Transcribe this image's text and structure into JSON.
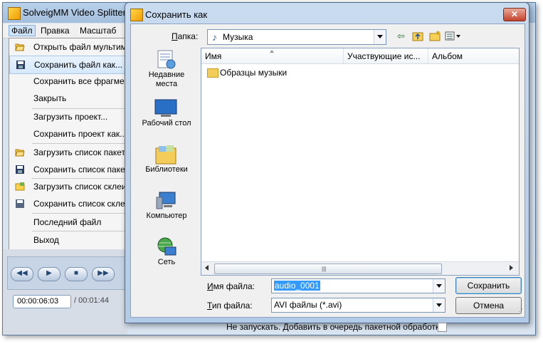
{
  "app": {
    "title": "SolveigMM Video Splitter",
    "menubar": [
      "Файл",
      "Правка",
      "Масштаб"
    ],
    "file_menu": [
      {
        "label": "Открыть файл мультим",
        "icon": "open-folder-icon"
      },
      {
        "label": "Сохранить файл как...",
        "icon": "floppy-icon",
        "highlighted": true
      },
      {
        "label": "Сохранить все фрагмен",
        "icon": ""
      },
      {
        "label": "Закрыть",
        "icon": ""
      },
      {
        "label": "Загрузить проект...",
        "icon": ""
      },
      {
        "label": "Сохранить проект как...",
        "icon": ""
      },
      {
        "label": "Загрузить список пакет",
        "icon": "open-folder-icon"
      },
      {
        "label": "Сохранить список паке",
        "icon": "floppy-icon"
      },
      {
        "label": "Загрузить список склеи",
        "icon": "folder-yellow-icon"
      },
      {
        "label": "Сохранить список скле",
        "icon": "floppy-grey-icon"
      },
      {
        "label": "Последний файл",
        "icon": ""
      },
      {
        "label": "Выход",
        "icon": ""
      }
    ],
    "time_current": "00:00:06:03",
    "time_total": "/ 00:01:44"
  },
  "dialog": {
    "title": "Сохранить как",
    "folder_label": "Папка:",
    "folder_label_key": "П",
    "folder_label_rest": "апка:",
    "folder_value": "Музыка",
    "places": [
      "Недавние места",
      "Рабочий стол",
      "Библиотеки",
      "Компьютер",
      "Сеть"
    ],
    "columns": [
      "Имя",
      "Участвующие ис...",
      "Альбом"
    ],
    "files": [
      {
        "name": "Образцы музыки",
        "type": "folder"
      }
    ],
    "filename_label_key": "И",
    "filename_label_rest": "мя файла:",
    "filename_value": "audio_0001",
    "filetype_label_key": "Т",
    "filetype_label_rest": "ип файла:",
    "filetype_value": "AVI файлы (*.avi)",
    "save_button": "Сохранить",
    "cancel_button": "Отмена",
    "batch_label": "Не запускать. Добавить в очередь пакетной обработки",
    "batch_checked": false
  }
}
